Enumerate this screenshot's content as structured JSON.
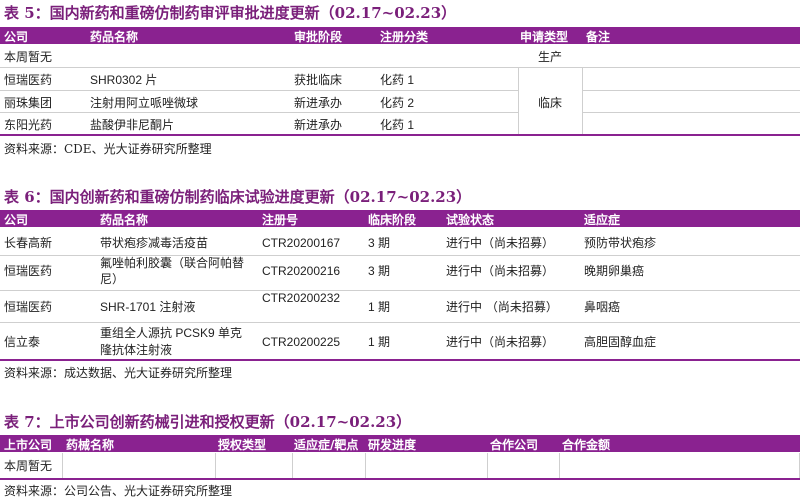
{
  "t5": {
    "title": "表 5：国内新药和重磅仿制药审评审批进度更新（02.17~02.23）",
    "headers": [
      "公司",
      "药品名称",
      "审批阶段",
      "注册分类",
      "申请类型",
      "备注"
    ],
    "row0": {
      "company": "本周暂无",
      "type": "生产"
    },
    "rows": [
      {
        "company": "恒瑞医药",
        "drug": "SHR0302 片",
        "stage": "获批临床",
        "cls": "化药 1"
      },
      {
        "company": "丽珠集团",
        "drug": "注射用阿立哌唑微球",
        "stage": "新进承办",
        "cls": "化药 2"
      },
      {
        "company": "东阳光药",
        "drug": "盐酸伊非尼酮片",
        "stage": "新进承办",
        "cls": "化药 1"
      }
    ],
    "merged_type": "临床",
    "source": "资料来源：CDE、光大证券研究所整理"
  },
  "t6": {
    "title": "表 6：国内创新药和重磅仿制药临床试验进度更新（02.17~02.23）",
    "headers": [
      "公司",
      "药品名称",
      "注册号",
      "临床阶段",
      "试验状态",
      "适应症"
    ],
    "rows": [
      {
        "company": "长春高新",
        "drug1": "带状疱疹减毒活疫苗",
        "drug2": "",
        "reg": "CTR20200167",
        "phase": "3 期",
        "status": "进行中（尚未招募）",
        "ind": "预防带状疱疹"
      },
      {
        "company": "恒瑞医药",
        "drug1": "氟唑帕利胶囊（联合阿帕替",
        "drug2": "尼）",
        "reg": "CTR20200216",
        "phase": "3 期",
        "status": "进行中（尚未招募）",
        "ind": "晚期卵巢癌"
      },
      {
        "company": "恒瑞医药",
        "drug1": "SHR-1701 注射液",
        "drug2": "",
        "reg": "CTR20200232",
        "phase": "1 期",
        "status": "进行中 （尚未招募）",
        "ind": "鼻咽癌"
      },
      {
        "company": "信立泰",
        "drug1": "重组全人源抗 PCSK9 单克",
        "drug2": "隆抗体注射液",
        "reg": "CTR20200225",
        "phase": "1 期",
        "status": "进行中（尚未招募）",
        "ind": "高胆固醇血症"
      }
    ],
    "source": "资料来源：成达数据、光大证券研究所整理"
  },
  "t7": {
    "title": "表 7：上市公司创新药械引进和授权更新（02.17~02.23）",
    "headers": [
      "上市公司",
      "药械名称",
      "授权类型",
      "适应症/靶点",
      "研发进度",
      "合作公司",
      "合作金额"
    ],
    "row0": {
      "company": "本周暂无"
    },
    "source": "资料来源：公司公告、光大证券研究所整理"
  }
}
